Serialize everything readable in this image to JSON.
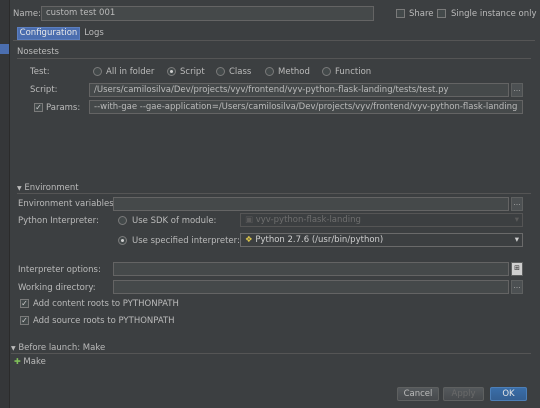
{
  "header": {
    "name_label": "Name:",
    "name_value": "custom test 001",
    "share_label": "Share",
    "single_instance_label": "Single instance only"
  },
  "tabs": [
    {
      "label": "Configuration",
      "active": true
    },
    {
      "label": "Logs",
      "active": false
    }
  ],
  "nosetests": {
    "group_label": "Nosetests",
    "test_label": "Test:",
    "test_options": [
      "All in folder",
      "Script",
      "Class",
      "Method",
      "Function"
    ],
    "selected_test_option": "Script",
    "script_label": "Script:",
    "script_value": "/Users/camilosilva/Dev/projects/vyv/frontend/vyv-python-flask-landing/tests/test.py",
    "params_label": "Params:",
    "params_checked": true,
    "params_value": "--with-gae --gae-application=/Users/camilosilva/Dev/projects/vyv/frontend/vyv-python-flask-landing"
  },
  "environment": {
    "section_label": "Environment",
    "env_vars_label": "Environment variables:",
    "env_vars_value": "",
    "python_interpreter_label": "Python Interpreter:",
    "use_sdk_label": "Use SDK of module:",
    "sdk_module_value": "vyv-python-flask-landing",
    "use_specified_label": "Use specified interpreter:",
    "interpreter_value": "Python 2.7.6 (/usr/bin/python)",
    "interpreter_options_label": "Interpreter options:",
    "interpreter_options_value": "",
    "working_directory_label": "Working directory:",
    "working_directory_value": "",
    "add_content_roots_label": "Add content roots to PYTHONPATH",
    "add_source_roots_label": "Add source roots to PYTHONPATH"
  },
  "before_launch": {
    "section_label": "Before launch: Make",
    "items": [
      "Make"
    ]
  },
  "footer": {
    "cancel_label": "Cancel",
    "apply_label": "Apply",
    "ok_label": "OK"
  },
  "icons": {
    "browse": "ellipsis-icon",
    "expand_field": "expand-icon"
  }
}
